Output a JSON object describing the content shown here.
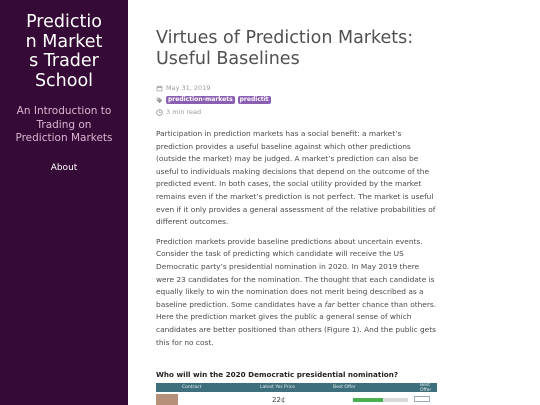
{
  "sidebar": {
    "site_title": "Prediction Markets Trader School",
    "tagline": "An Introduction to Trading on Prediction Markets",
    "nav": {
      "about": "About"
    }
  },
  "post": {
    "title": "Virtues of Prediction Markets: Useful Baselines",
    "date": "May 31, 2019",
    "tags": [
      "prediction-markets",
      "predictit"
    ],
    "read_time": "3 min read",
    "paragraphs": [
      {
        "text": "Participation in prediction markets has a social benefit: a market’s prediction provides a useful baseline against which other predictions (outside the market) may be judged. A market’s prediction can also be useful to individuals making decisions that depend on the outcome of the predicted event. In both cases, the social utility provided by the market remains even if the market’s prediction is not perfect. The market is useful even if it only provides a general assessment of the relative probabilities of different outcomes."
      },
      {
        "before_em": "Prediction markets provide baseline predictions about uncertain events. Consider the task of predicting which candidate will receive the US Democratic party’s presidential nomination in 2020. In May 2019 there were 23 candidates for the nomination. The thought that each candidate is equally likely to win the nomination does not merit being described as a baseline prediction. Some candidates have a ",
        "em": "far",
        "after_em": " better chance than others. Here the prediction market gives the public a general sense of which candidates are better positioned than others (Figure 1). And the public gets this for no cost."
      }
    ]
  },
  "figure": {
    "title": "Who will win the 2020 Democratic presidential nomination?",
    "columns": [
      "Contract",
      "Latest Yes Price",
      "Best Offer",
      "Best Offer"
    ],
    "first_row": {
      "value": "22¢",
      "bar_fill": 0.55
    }
  },
  "colors": {
    "sidebar_bg": "#350a36",
    "tagline": "#d8b6d2",
    "tag_bg": "#8a5fb2",
    "figure_header": "#3d6f7c"
  },
  "icons": {
    "date": "calendar-icon",
    "tags": "tag-icon",
    "read": "clock-icon"
  }
}
